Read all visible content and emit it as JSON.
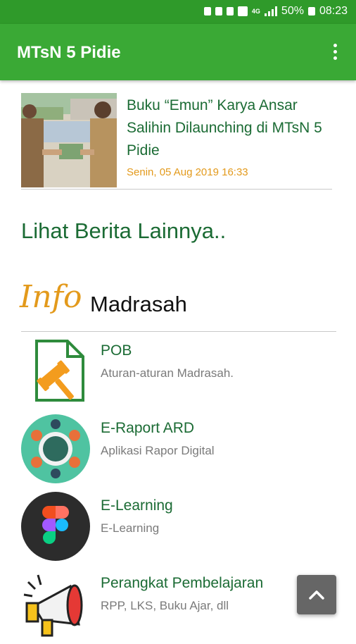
{
  "status_bar": {
    "network": "4G",
    "battery": "50%",
    "time": "08:23"
  },
  "app_bar": {
    "title": "MTsN 5 Pidie",
    "menu_icon": "more-vert-icon"
  },
  "news": {
    "title": "Buku “Emun” Karya Ansar Salihin Dilaunching di MTsN 5 Pidie",
    "date": "Senin, 05 Aug 2019 16:33"
  },
  "more_news_label": "Lihat Berita Lainnya..",
  "section": {
    "script_label": "Info",
    "title": "Madrasah"
  },
  "items": [
    {
      "title": "POB",
      "subtitle": "Aturan-aturan Madrasah.",
      "icon": "document-gavel-icon"
    },
    {
      "title": "E-Raport ARD",
      "subtitle": "Aplikasi Rapor Digital",
      "icon": "meeting-table-icon"
    },
    {
      "title": "E-Learning",
      "subtitle": "E-Learning",
      "icon": "figma-logo-icon"
    },
    {
      "title": "Perangkat Pembelajaran",
      "subtitle": "RPP, LKS, Buku Ajar, dll",
      "icon": "megaphone-icon"
    }
  ],
  "fab": {
    "icon": "chevron-up-icon"
  },
  "colors": {
    "status_bar": "#2f9a2a",
    "app_bar": "#3aa935",
    "primary_text": "#1b6b34",
    "accent": "#e39a1c"
  }
}
